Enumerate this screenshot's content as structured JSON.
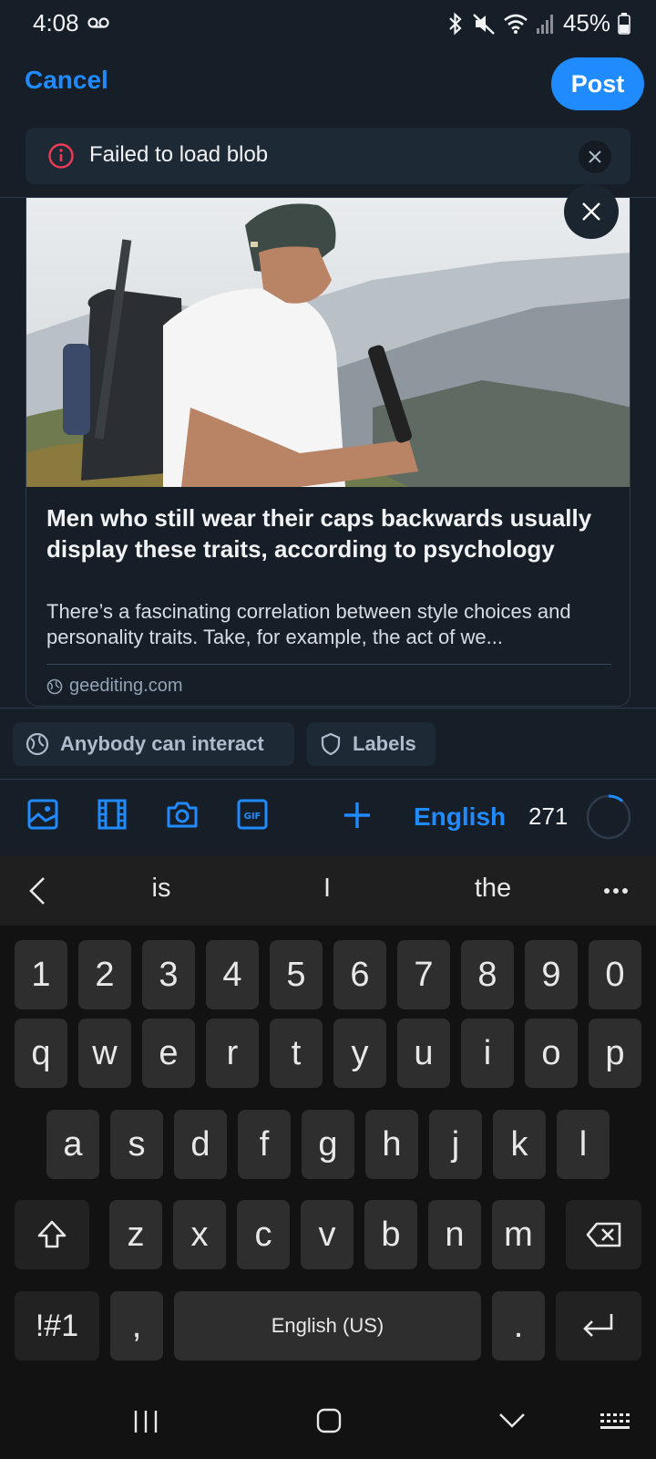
{
  "status": {
    "time": "4:08",
    "battery": "45%"
  },
  "header": {
    "cancel": "Cancel",
    "post": "Post"
  },
  "error": {
    "text": "Failed to load blob"
  },
  "card": {
    "title": "Men who still wear their caps backwards usually display these traits, according to psychology",
    "description": "There’s a fascinating correlation between style choices and personality traits. Take, for example, the act of we...",
    "domain": "geediting.com"
  },
  "chips": {
    "interact": "Anybody can interact",
    "labels": "Labels"
  },
  "toolbar": {
    "icons": [
      "image-icon",
      "video-icon",
      "camera-icon",
      "gif-icon",
      "plus-icon"
    ],
    "gif_text": "GIF",
    "language": "English",
    "char_count": "271"
  },
  "keyboard": {
    "suggestions": [
      "is",
      "I",
      "the"
    ],
    "row_numbers": [
      "1",
      "2",
      "3",
      "4",
      "5",
      "6",
      "7",
      "8",
      "9",
      "0"
    ],
    "row1": [
      "q",
      "w",
      "e",
      "r",
      "t",
      "y",
      "u",
      "i",
      "o",
      "p"
    ],
    "row2": [
      "a",
      "s",
      "d",
      "f",
      "g",
      "h",
      "j",
      "k",
      "l"
    ],
    "row3": [
      "z",
      "x",
      "c",
      "v",
      "b",
      "n",
      "m"
    ],
    "symbols": "!#1",
    "comma": ",",
    "space": "English (US)",
    "period": "."
  }
}
